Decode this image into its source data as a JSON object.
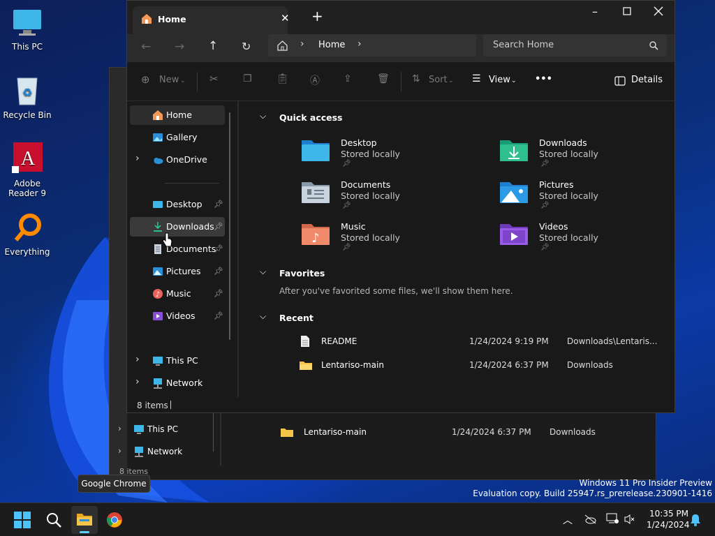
{
  "desktop": {
    "icons": [
      {
        "label": "This PC"
      },
      {
        "label": "Recycle Bin"
      },
      {
        "label": "Adobe Reader 9"
      },
      {
        "label": "Everything"
      }
    ]
  },
  "window": {
    "tab_title": "Home",
    "new_tab": "+",
    "breadcrumb": "Home",
    "search_placeholder": "Search Home",
    "toolbar": {
      "new": "New",
      "sort": "Sort",
      "view": "View",
      "more": "•••",
      "details": "Details"
    },
    "sidebar": {
      "top": [
        "Home",
        "Gallery",
        "OneDrive"
      ],
      "pinned": [
        "Desktop",
        "Downloads",
        "Documents",
        "Pictures",
        "Music",
        "Videos"
      ],
      "bottom": [
        "This PC",
        "Network"
      ]
    },
    "quick_access": {
      "title": "Quick access",
      "items": [
        {
          "name": "Desktop",
          "sub": "Stored locally"
        },
        {
          "name": "Downloads",
          "sub": "Stored locally"
        },
        {
          "name": "Documents",
          "sub": "Stored locally"
        },
        {
          "name": "Pictures",
          "sub": "Stored locally"
        },
        {
          "name": "Music",
          "sub": "Stored locally"
        },
        {
          "name": "Videos",
          "sub": "Stored locally"
        }
      ]
    },
    "favorites": {
      "title": "Favorites",
      "empty": "After you've favorited some files, we'll show them here."
    },
    "recent": {
      "title": "Recent",
      "rows": [
        {
          "name": "README",
          "date": "1/24/2024 9:19 PM",
          "location": "Downloads\\Lentaris..."
        },
        {
          "name": "Lentariso-main",
          "date": "1/24/2024 6:37 PM",
          "location": "Downloads"
        }
      ]
    },
    "status": "8 items"
  },
  "back_window": {
    "sidebar_bottom": [
      "This PC",
      "Network"
    ],
    "row": {
      "name": "Lentariso-main",
      "date": "1/24/2024 6:37 PM",
      "location": "Downloads"
    },
    "status": "8 items"
  },
  "tooltip": "Google Chrome",
  "watermark": {
    "line1": "Windows 11 Pro Insider Preview",
    "line2": "Evaluation copy. Build 25947.rs_prerelease.230901-1416"
  },
  "clock": {
    "time": "10:35 PM",
    "date": "1/24/2024"
  },
  "colors": {
    "accent": "#60cdff",
    "folder": "#f4c54a"
  }
}
